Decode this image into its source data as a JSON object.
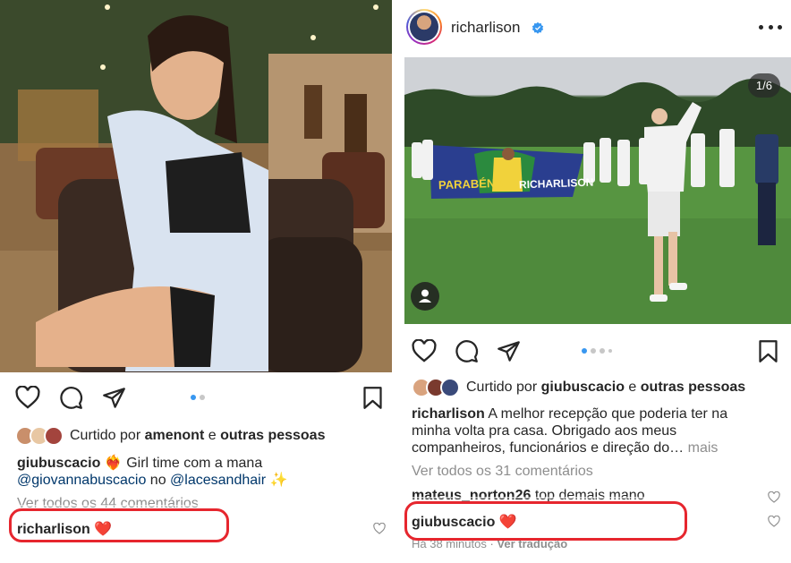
{
  "left_post": {
    "photo_description_icon": "photo",
    "carousel_dots": 2,
    "carousel_active": 0,
    "liked": {
      "prefix": "Curtido por",
      "user": "amenont",
      "joiner": "e",
      "others": "outras pessoas"
    },
    "caption": {
      "user": "giubuscacio",
      "emoji": "❤️‍🔥",
      "text": "Girl time com a mana",
      "mention1": "@giovannabuscacio",
      "joiner": "no",
      "mention2": "@lacesandhair",
      "sparkle": "✨"
    },
    "view_comments": "Ver todos os 44 comentários",
    "comment": {
      "user": "richarlison",
      "emoji": "❤️"
    }
  },
  "right_post": {
    "header": {
      "username": "richarlison",
      "verified": true
    },
    "counter": "1/6",
    "banner": {
      "left": "PARABÉNS",
      "right": "RICHARLISON"
    },
    "carousel_dots": 6,
    "carousel_active": 0,
    "liked": {
      "prefix": "Curtido por",
      "user": "giubuscacio",
      "joiner": "e",
      "others": "outras pessoas"
    },
    "caption": {
      "user": "richarlison",
      "text_line1": "A melhor recepção que poderia ter na",
      "text_line2": "minha volta pra casa. Obrigado aos meus",
      "text_line3": "companheiros, funcionários e direção do…",
      "more": "mais"
    },
    "view_comments": "Ver todos os 31 comentários",
    "comment1": {
      "user": "mateus_norton26",
      "text": "top demais mano"
    },
    "comment2": {
      "user": "giubuscacio",
      "emoji": "❤️"
    },
    "comment_meta": {
      "time": "Há 38 minutos",
      "sep": "·",
      "translate": "Ver tradução"
    }
  },
  "colors": {
    "highlight": "#e6262e",
    "link": "#00376b",
    "muted": "#8e8e8e",
    "active_dot": "#3897f0",
    "verified": "#3897f0"
  },
  "icons": [
    "heart-icon",
    "comment-icon",
    "share-icon",
    "bookmark-icon",
    "more-icon",
    "verified-badge-icon",
    "user-tag-icon"
  ]
}
